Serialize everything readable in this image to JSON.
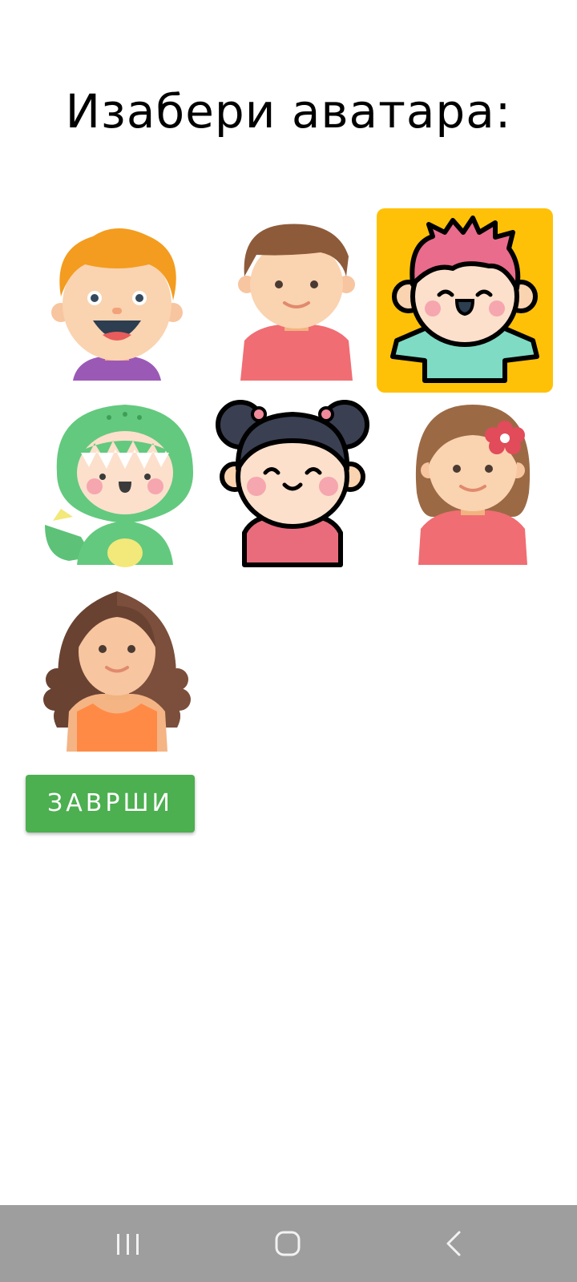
{
  "header": {
    "title": "Изабери аватара:"
  },
  "avatars": [
    {
      "name": "boy-orange-hair",
      "selected": false
    },
    {
      "name": "boy-brown-hair",
      "selected": false
    },
    {
      "name": "boy-pink-hair",
      "selected": true
    },
    {
      "name": "dino-costume-kid",
      "selected": false
    },
    {
      "name": "girl-buns",
      "selected": false
    },
    {
      "name": "girl-flower",
      "selected": false
    },
    {
      "name": "girl-curly-hair",
      "selected": false
    }
  ],
  "actions": {
    "finish_label": "ЗАВРШИ"
  },
  "colors": {
    "accent_selected": "#FFC107",
    "finish_button": "#4CAF50",
    "nav_bar": "#9E9E9E"
  },
  "navigation": {
    "recents_icon": "recents-icon",
    "home_icon": "home-icon",
    "back_icon": "back-icon"
  }
}
